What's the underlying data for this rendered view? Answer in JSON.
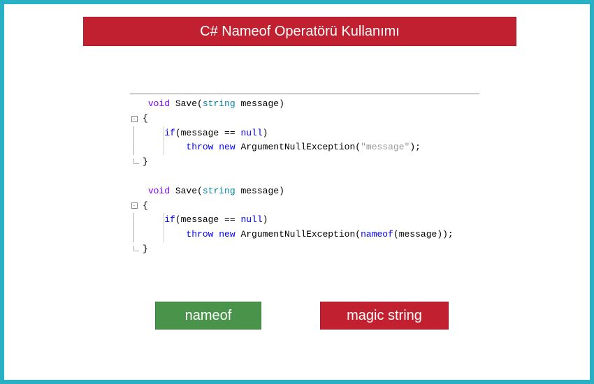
{
  "header": {
    "title": "C# Nameof Operatörü Kullanımı"
  },
  "code": {
    "block1": {
      "line1_void": "void",
      "line1_name": " Save(",
      "line1_string": "string",
      "line1_param": " message)",
      "line2": "{",
      "line3_pre": "    ",
      "line3_if": "if",
      "line3_cond": "(message == ",
      "line3_null": "null",
      "line3_end": ")",
      "line4_pre": "        ",
      "line4_throw": "throw",
      "line4_sp": " ",
      "line4_new": "new",
      "line4_ex": " ArgumentNullException(",
      "line4_str": "\"message\"",
      "line4_end": ");",
      "line5": "}"
    },
    "block2": {
      "line1_void": "void",
      "line1_name": " Save(",
      "line1_string": "string",
      "line1_param": " message)",
      "line2": "{",
      "line3_pre": "    ",
      "line3_if": "if",
      "line3_cond": "(message == ",
      "line3_null": "null",
      "line3_end": ")",
      "line4_pre": "        ",
      "line4_throw": "throw",
      "line4_sp": " ",
      "line4_new": "new",
      "line4_ex": " ArgumentNullException(",
      "line4_nameof": "nameof",
      "line4_arg": "(message));",
      "line5": "}"
    }
  },
  "badges": {
    "nameof": "nameof",
    "magic_string": "magic string"
  },
  "colors": {
    "frame": "#29b0c4",
    "red": "#c12030",
    "green": "#4a934a"
  }
}
